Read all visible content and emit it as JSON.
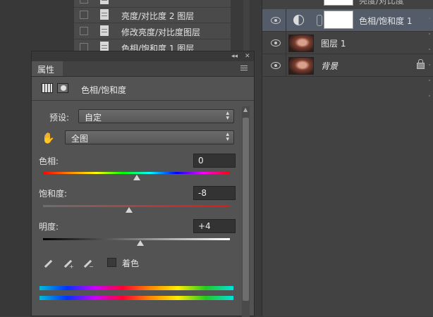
{
  "history": {
    "items": [
      {
        "label": ""
      },
      {
        "label": "亮度/对比度 2 图层"
      },
      {
        "label": "修改亮度/对比度图层"
      },
      {
        "label": "色相/饱和度 1 图层"
      }
    ]
  },
  "layers": {
    "top_partial_label": "亮度/对比度",
    "items": [
      {
        "name": "色相/饱和度 1"
      },
      {
        "name": "图层 1"
      },
      {
        "name": "背景"
      }
    ]
  },
  "properties": {
    "tab_label": "属性",
    "header_label": "色相/饱和度",
    "preset": {
      "label": "预设:",
      "value": "自定"
    },
    "channel": {
      "value": "全图"
    },
    "hue": {
      "label": "色相:",
      "value": "0",
      "level": 0
    },
    "saturation": {
      "label": "饱和度:",
      "value": "-8",
      "level": -8
    },
    "lightness": {
      "label": "明度:",
      "value": "+4",
      "level": 4
    },
    "colorize_label": "着色",
    "colorize_checked": false
  }
}
